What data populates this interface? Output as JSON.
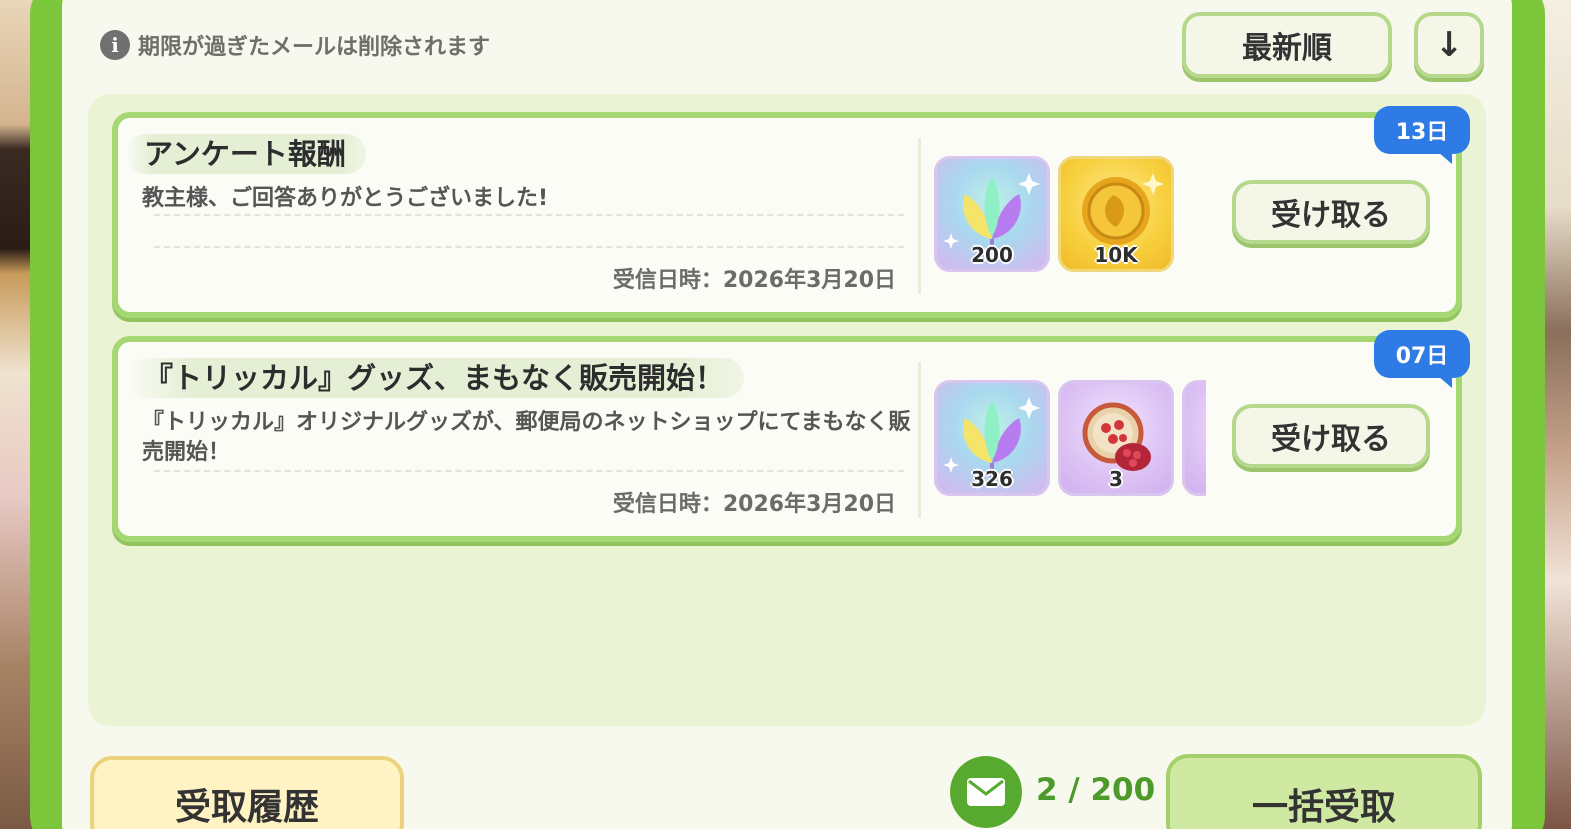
{
  "notice": {
    "icon": "info-icon",
    "text": "期限が過ぎたメールは削除されます"
  },
  "sort": {
    "label": "最新順",
    "direction_icon": "sort-direction-icon",
    "direction_glyph": "↓"
  },
  "mails": [
    {
      "title": "アンケート報酬",
      "body": "教主様、ご回答ありがとうございました!",
      "date": "受信日時：2026年3月20日",
      "days_left": "13日",
      "claim_label": "受け取る",
      "rewards": [
        {
          "type": "crystal",
          "icon": "leaf-crystal-icon",
          "qty": "200"
        },
        {
          "type": "coin",
          "icon": "gold-coin-icon",
          "qty": "10K"
        }
      ]
    },
    {
      "title": "『トリッカル』グッズ、まもなく販売開始！",
      "body": "『トリッカル』オリジナルグッズが、郵便局のネットショップにてまもなく販売開始！",
      "date": "受信日時：2026年3月20日",
      "days_left": "07日",
      "claim_label": "受け取る",
      "rewards": [
        {
          "type": "crystal",
          "icon": "leaf-crystal-icon",
          "qty": "326"
        },
        {
          "type": "fruit",
          "icon": "pomegranate-icon",
          "qty": "3"
        },
        {
          "type": "fruit",
          "icon": "pomegranate-icon",
          "qty": ""
        }
      ]
    }
  ],
  "footer": {
    "history_label": "受取履歴",
    "mail_count": "2 / 200",
    "bulk_claim_label": "一括受取"
  },
  "colors": {
    "frame": "#7cc63c",
    "card_border": "#a5d873",
    "badge": "#2f7be6",
    "count_text": "#4c9a2a"
  }
}
